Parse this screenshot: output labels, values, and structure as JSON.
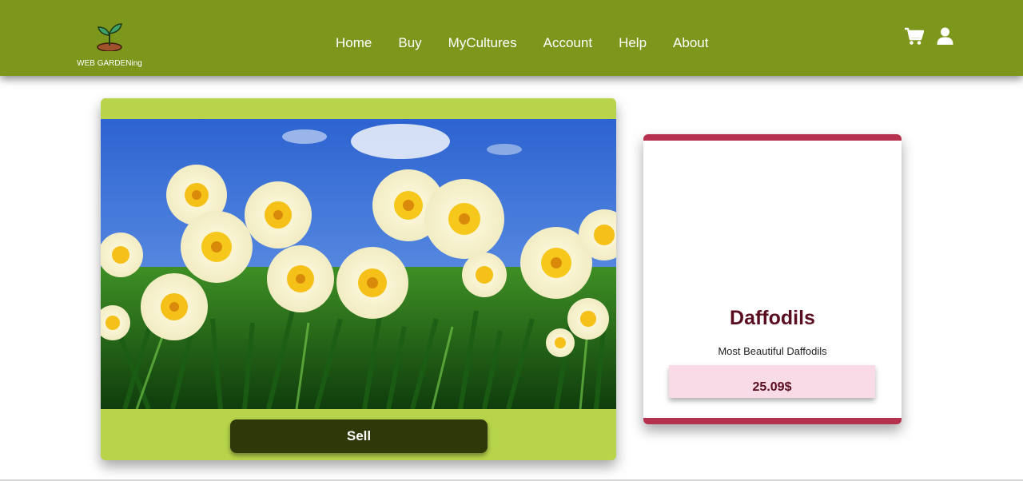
{
  "brand": {
    "name": "WEB GARDENing",
    "logo_icon": "sprout-icon"
  },
  "nav": {
    "items": [
      {
        "label": "Home"
      },
      {
        "label": "Buy"
      },
      {
        "label": "MyCultures"
      },
      {
        "label": "Account"
      },
      {
        "label": "Help"
      },
      {
        "label": "About"
      }
    ],
    "icons": [
      "cart-icon",
      "user-icon"
    ]
  },
  "hero": {
    "image": "daffodils-photo",
    "sell_label": "Sell"
  },
  "product": {
    "name": "Daffodils",
    "description": "Most Beautiful Daffodils",
    "price": "25.09$"
  },
  "colors": {
    "navbar": "#7d961c",
    "card_green": "#b7d44a",
    "sell_button": "#2f3809",
    "accent_red": "#b5314e",
    "price_bg": "#f8dbe6",
    "product_text": "#5a0d1f"
  }
}
